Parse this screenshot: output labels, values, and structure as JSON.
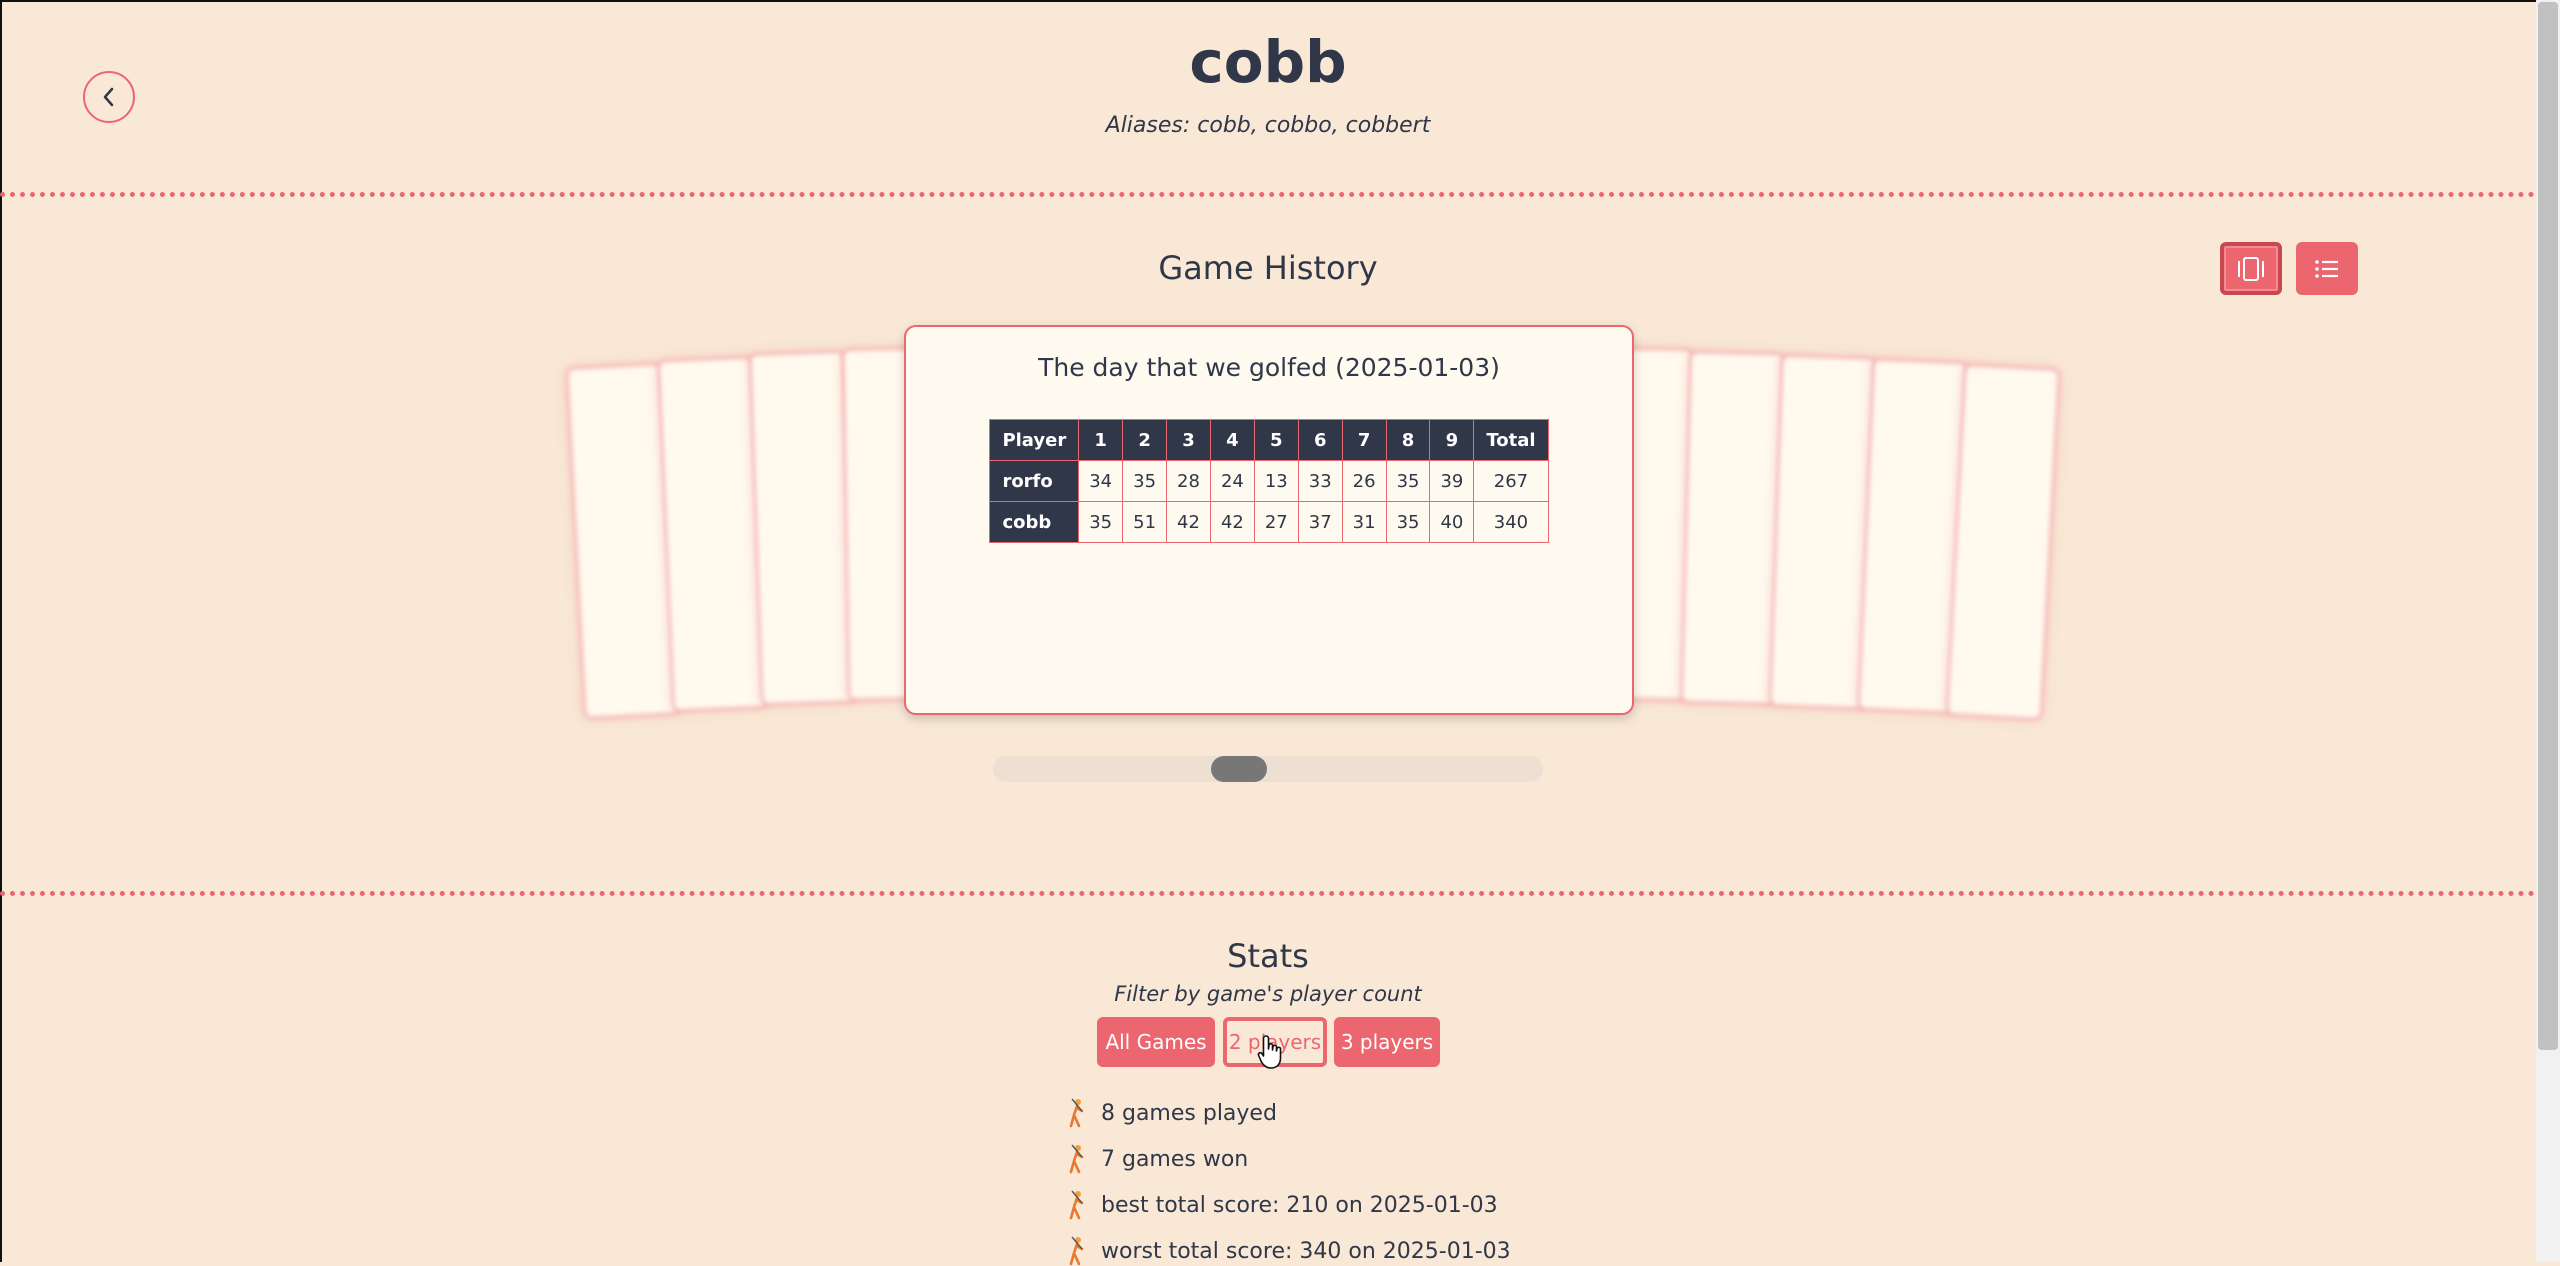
{
  "player": {
    "name": "cobb",
    "aliases_text": "Aliases: cobb, cobbo, cobbert"
  },
  "history": {
    "title": "Game History",
    "view_buttons": [
      "carousel-view-icon",
      "list-view-icon"
    ],
    "current_game": {
      "title": "The day that we golfed (2025-01-03)",
      "headers": [
        "Player",
        "1",
        "2",
        "3",
        "4",
        "5",
        "6",
        "7",
        "8",
        "9",
        "Total"
      ],
      "rows": [
        {
          "player": "rorfo",
          "scores": [
            "34",
            "35",
            "28",
            "24",
            "13",
            "33",
            "26",
            "35",
            "39"
          ],
          "total": "267"
        },
        {
          "player": "cobb",
          "scores": [
            "35",
            "51",
            "42",
            "42",
            "27",
            "37",
            "31",
            "35",
            "40"
          ],
          "total": "340"
        }
      ]
    }
  },
  "stats": {
    "title": "Stats",
    "filter_label": "Filter by game's player count",
    "filters": [
      {
        "label": "All Games",
        "selected": false
      },
      {
        "label": "2 players",
        "selected": true
      },
      {
        "label": "3 players",
        "selected": false
      }
    ],
    "items": [
      "8 games played",
      "7 games won",
      "best total score: 210 on 2025-01-03",
      "worst total score: 340 on 2025-01-03"
    ]
  },
  "colors": {
    "accent": "#ec6670",
    "background": "#f9e8d6",
    "dark": "#2f3748"
  }
}
